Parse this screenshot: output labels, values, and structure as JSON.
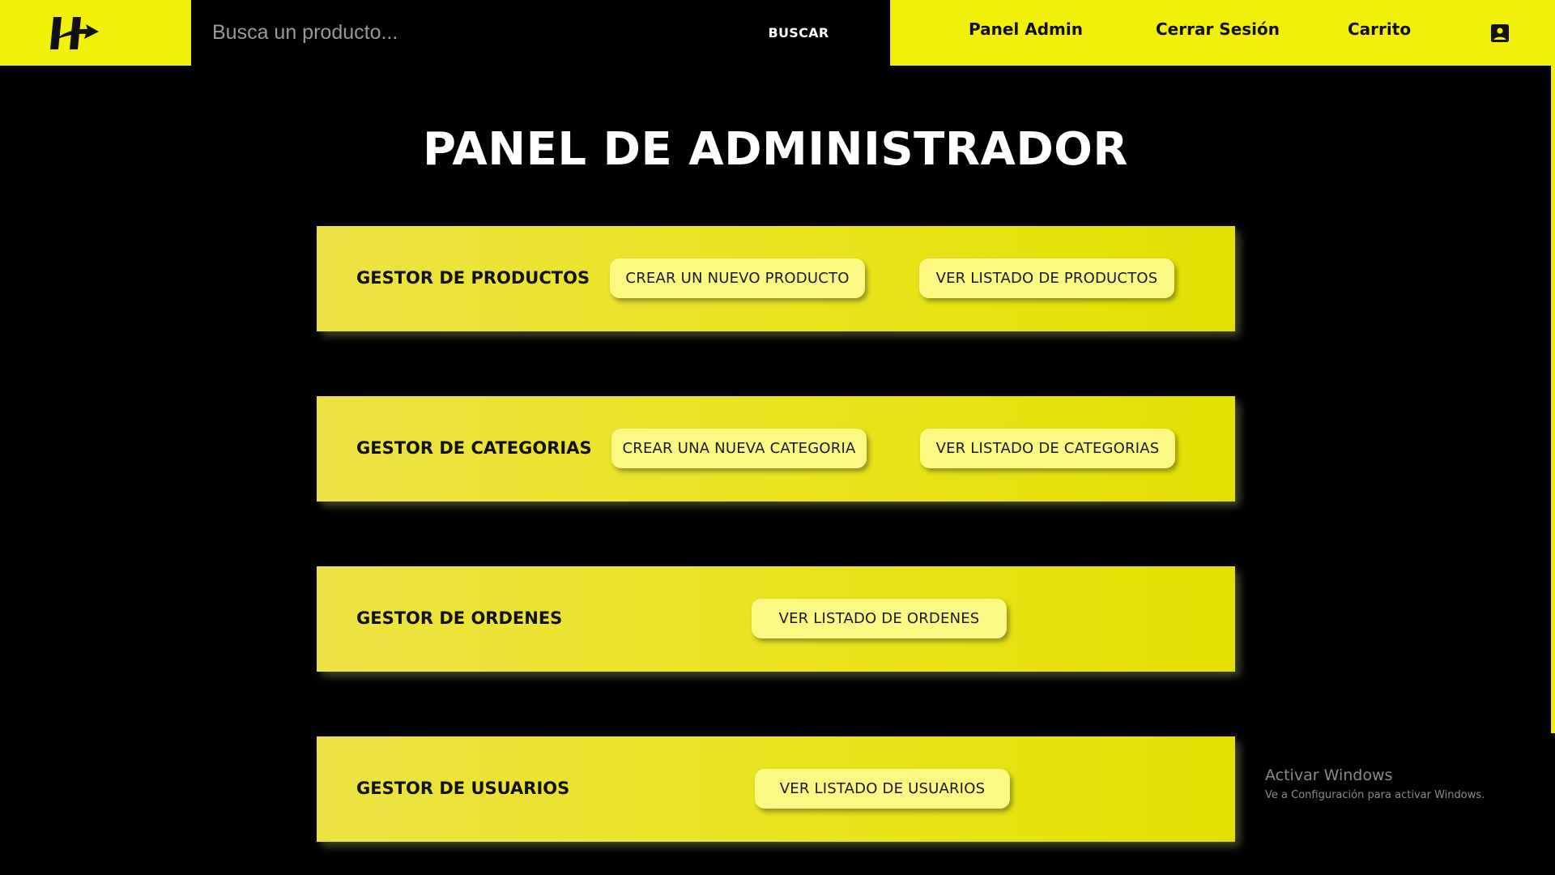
{
  "header": {
    "logo_icon": "h-arrow-logo-icon",
    "search": {
      "placeholder": "Busca un producto...",
      "value": "",
      "button_label": "BUSCAR"
    },
    "nav": {
      "admin_label": "Panel Admin",
      "logout_label": "Cerrar Sesión",
      "cart_label": "Carrito",
      "account_icon": "account-box-icon"
    }
  },
  "main": {
    "title": "PANEL DE ADMINISTRADOR",
    "panels": [
      {
        "title": "GESTOR DE PRODUCTOS",
        "buttons": [
          "CREAR UN NUEVO PRODUCTO",
          "VER LISTADO DE PRODUCTOS"
        ]
      },
      {
        "title": "GESTOR DE CATEGORIAS",
        "buttons": [
          "CREAR UNA NUEVA CATEGORIA",
          "VER LISTADO DE CATEGORIAS"
        ]
      },
      {
        "title": "GESTOR DE ORDENES",
        "buttons": [
          "VER LISTADO DE ORDENES"
        ]
      },
      {
        "title": "GESTOR DE USUARIOS",
        "buttons": [
          "VER LISTADO DE USUARIOS"
        ]
      }
    ]
  },
  "watermark": {
    "title": "Activar Windows",
    "subtitle": "Ve a Configuración para activar Windows."
  },
  "colors": {
    "brand_yellow": "#f2ef0a",
    "panel_gradient_start": "#ede245",
    "panel_gradient_end": "#e3e000",
    "button_yellow": "#fbf883",
    "background": "#000000"
  }
}
